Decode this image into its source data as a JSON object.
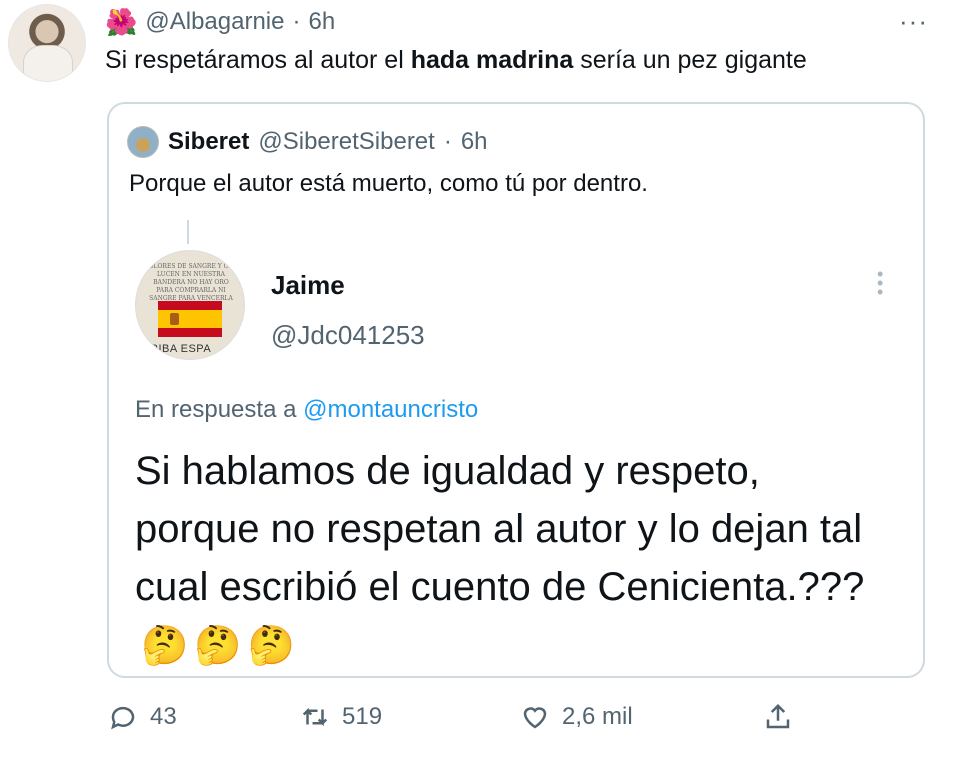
{
  "tweet": {
    "username": "@Albagarnie",
    "separator": "·",
    "time": "6h",
    "flower_icon": "🌺",
    "text_before": "Si respetáramos al autor el ",
    "text_bold": "hada madrina",
    "text_after": " sería un pez gigante",
    "more_icon": "···"
  },
  "quote": {
    "name": "Siberet",
    "handle": "@SiberetSiberet",
    "separator": "·",
    "time": "6h",
    "text": "Porque el autor está muerto, como tú por dentro."
  },
  "screenshot": {
    "avatar_text": "COLORES DE SANGRE Y ORO LUCEN EN NUESTRA BANDERA NO HAY ORO PARA COMPRARLA NI SANGRE PARA VENCERLA",
    "avatar_tag": "RIBA ESPA",
    "name": "Jaime",
    "handle": "@Jdc041253",
    "reply_prefix": "En respuesta a ",
    "reply_mention": "@montauncristo",
    "body": "Si hablamos de igualdad y respeto, porque no respetan al autor y lo dejan tal cual escribió el cuento de Cenicienta.???",
    "emojis": [
      "🤔",
      "🤔",
      "🤔"
    ]
  },
  "actions": {
    "replies": "43",
    "retweets": "519",
    "likes": "2,6 mil"
  },
  "icons": {
    "reply": "reply-icon",
    "retweet": "retweet-icon",
    "like": "heart-icon",
    "share": "share-icon"
  },
  "colors": {
    "link": "#1d9bf0",
    "secondary_text": "#536471",
    "border": "#cfd9de"
  }
}
